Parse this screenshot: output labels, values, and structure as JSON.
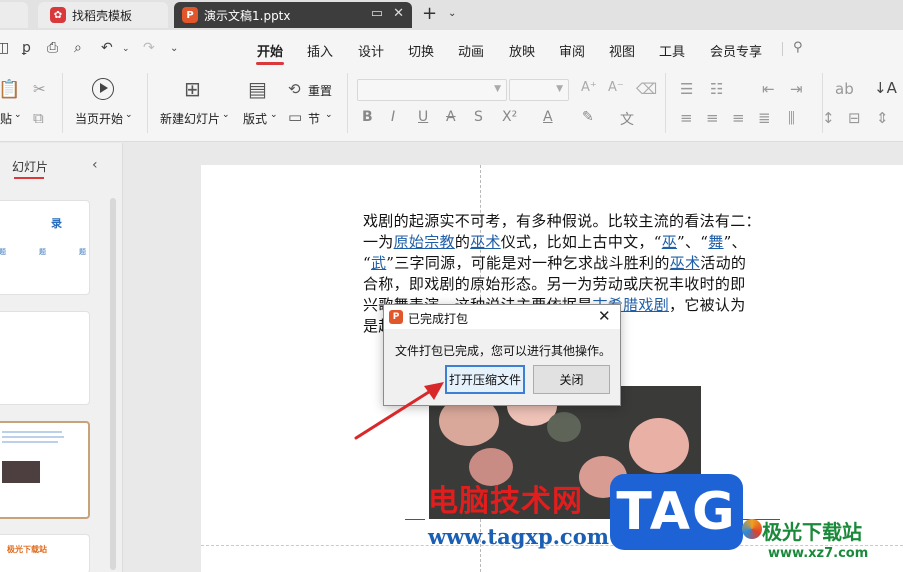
{
  "tabs": [
    {
      "label": "",
      "logo": ""
    },
    {
      "label": "找稻壳模板",
      "logo": "wps-daoke-icon"
    },
    {
      "label": "演示文稿1.pptx",
      "logo": "P",
      "active": true
    }
  ],
  "menu": {
    "items": [
      "开始",
      "插入",
      "设计",
      "切换",
      "动画",
      "放映",
      "审阅",
      "视图",
      "工具",
      "会员专享"
    ],
    "active": "开始"
  },
  "ribbon": {
    "paste_label": "贴",
    "start_from_current": "当页开始",
    "new_slide": "新建幻灯片",
    "layout": "版式",
    "reset": "重置",
    "section": "节"
  },
  "left_panel": {
    "title": "幻灯片",
    "thumb1_title": "录",
    "thumb1_items": [
      "题",
      "题",
      "题"
    ],
    "thumb4_text": "极光下载站"
  },
  "slide": {
    "lines": [
      [
        {
          "t": "戏剧的起源实不可考，有多种假说。比较主流的看法有二："
        }
      ],
      [
        {
          "t": "一为"
        },
        {
          "t": "原始宗教",
          "link": true
        },
        {
          "t": "的"
        },
        {
          "t": "巫术",
          "link": true
        },
        {
          "t": "仪式，比如上古中文，“"
        },
        {
          "t": "巫",
          "link": true
        },
        {
          "t": "”、“"
        },
        {
          "t": "舞",
          "link": true
        },
        {
          "t": "”、"
        }
      ],
      [
        {
          "t": "“"
        },
        {
          "t": "武",
          "link": true
        },
        {
          "t": "”三字同源，可能是对一种乞求战斗胜利的"
        },
        {
          "t": "巫术",
          "link": true
        },
        {
          "t": "活动的"
        }
      ],
      [
        {
          "t": "合称，即戏剧的原始形态。另一为劳动或庆祝丰收时的即"
        }
      ],
      [
        {
          "t": "兴歌舞表演，这种说法主要依据是"
        },
        {
          "t": "古希腊戏剧",
          "link": true
        },
        {
          "t": "，它被认为"
        }
      ],
      [
        {
          "t": "是起源于"
        }
      ]
    ]
  },
  "dialog": {
    "title": "已完成打包",
    "message": "文件打包已完成，您可以进行其他操作。",
    "open_button": "打开压缩文件",
    "close_button": "关闭"
  },
  "watermarks": {
    "site_name": "电脑技术网",
    "site_url": "www.tagxp.com",
    "tag": "TAG",
    "jiguang_name": "极光下载站",
    "jiguang_url": "www.xz7.com"
  },
  "colors": {
    "accent_red": "#d9393b",
    "link_blue": "#1f5fa8",
    "dialog_focus": "#3c7fd4",
    "arrow_red": "#d8282a"
  }
}
